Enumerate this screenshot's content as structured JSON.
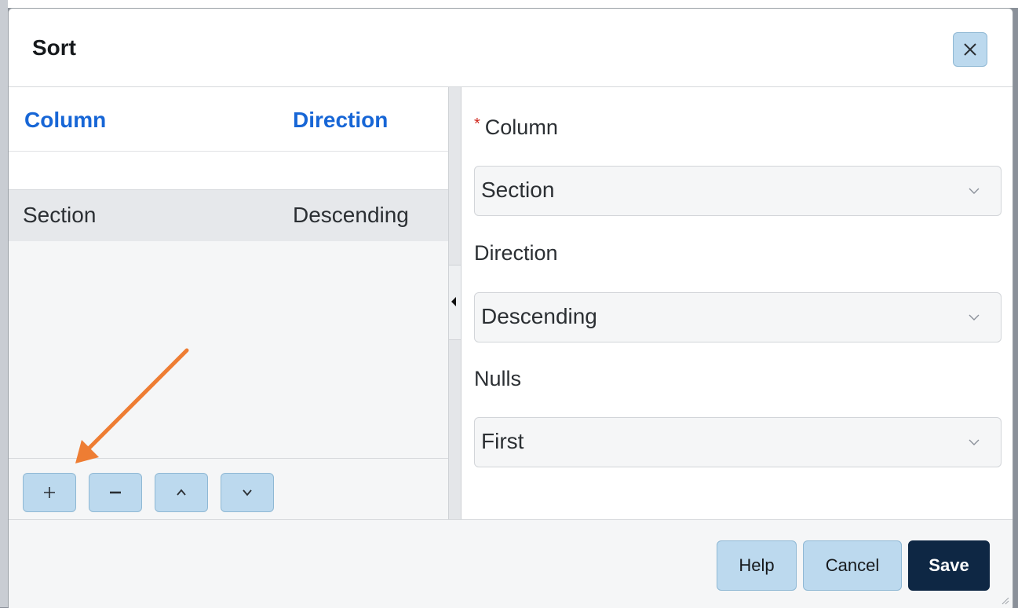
{
  "dialog": {
    "title": "Sort",
    "close_icon": "close-icon"
  },
  "sort_list": {
    "columns": [
      "Column",
      "Direction"
    ],
    "rows": [
      {
        "column": "Section",
        "direction": "Descending"
      }
    ]
  },
  "toolbar": {
    "buttons": [
      {
        "name": "add-sort-button",
        "icon": "plus-icon"
      },
      {
        "name": "remove-sort-button",
        "icon": "minus-icon"
      },
      {
        "name": "move-up-button",
        "icon": "chevron-up-icon"
      },
      {
        "name": "move-down-button",
        "icon": "chevron-down-icon"
      }
    ]
  },
  "form": {
    "required_mark": "*",
    "column_label": "Column",
    "column_value": "Section",
    "direction_label": "Direction",
    "direction_value": "Descending",
    "nulls_label": "Nulls",
    "nulls_value": "First"
  },
  "footer": {
    "help_label": "Help",
    "cancel_label": "Cancel",
    "save_label": "Save"
  },
  "colors": {
    "accent_blue": "#1766d6",
    "button_light": "#bcd9ee",
    "button_primary": "#0e2744",
    "required_red": "#d0281f",
    "annotation_arrow": "#ee7d33"
  }
}
